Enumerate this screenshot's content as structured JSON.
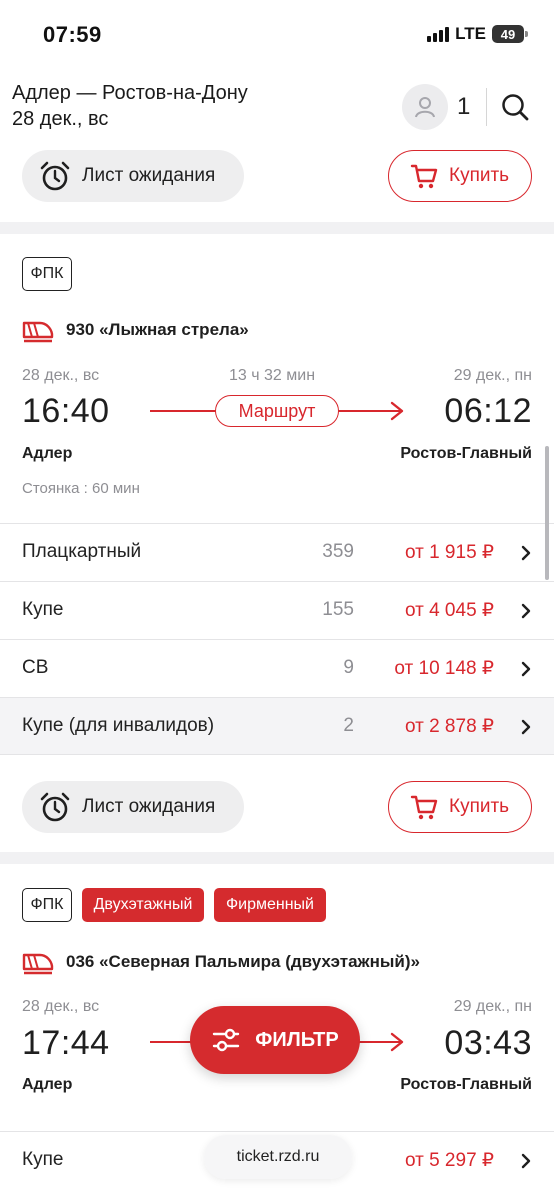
{
  "status_bar": {
    "time": "07:59",
    "network": "LTE",
    "battery": "49"
  },
  "header": {
    "route": "Адлер — Ростов-на-Дону",
    "date": "28 дек., вс",
    "passengers": "1"
  },
  "top_actions": {
    "wait_label": "Лист ожидания",
    "buy_label": "Купить"
  },
  "trains": [
    {
      "carrier": "ФПК",
      "name": "930 «Лыжная стрела»",
      "dep_date": "28 дек., вс",
      "duration": "13 ч 32 мин",
      "arr_date": "29 дек., пн",
      "dep_time": "16:40",
      "route_label": "Маршрут",
      "arr_time": "06:12",
      "dep_station": "Адлер",
      "arr_station": "Ростов-Главный",
      "stop": "Стоянка : 60 мин",
      "classes": [
        {
          "name": "Плацкартный",
          "seats": "359",
          "price": "от 1 915 ₽"
        },
        {
          "name": "Купе",
          "seats": "155",
          "price": "от 4 045 ₽"
        },
        {
          "name": "СВ",
          "seats": "9",
          "price": "от 10 148 ₽"
        },
        {
          "name": "Купе (для инвалидов)",
          "seats": "2",
          "price": "от 2 878 ₽"
        }
      ],
      "wait_label": "Лист ожидания",
      "buy_label": "Купить"
    },
    {
      "carrier": "ФПК",
      "tags": [
        "Двухэтажный",
        "Фирменный"
      ],
      "name": "036 «Северная Пальмира (двухэтажный)»",
      "dep_date": "28 дек., вс",
      "arr_date": "29 дек., пн",
      "dep_time": "17:44",
      "arr_time": "03:43",
      "dep_station": "Адлер",
      "arr_station": "Ростов-Главный",
      "classes": [
        {
          "name": "Купе",
          "price": "от 5 297 ₽"
        }
      ]
    }
  ],
  "filter_button": "ФИЛЬТР",
  "browser_url": "ticket.rzd.ru",
  "colors": {
    "accent": "#d8272d",
    "tag_red": "#d52b2e",
    "muted": "#8e8e93"
  },
  "icons": [
    "alarm-clock-icon",
    "cart-icon",
    "train-icon",
    "chevron-right-icon",
    "search-icon",
    "user-icon",
    "sliders-icon"
  ]
}
